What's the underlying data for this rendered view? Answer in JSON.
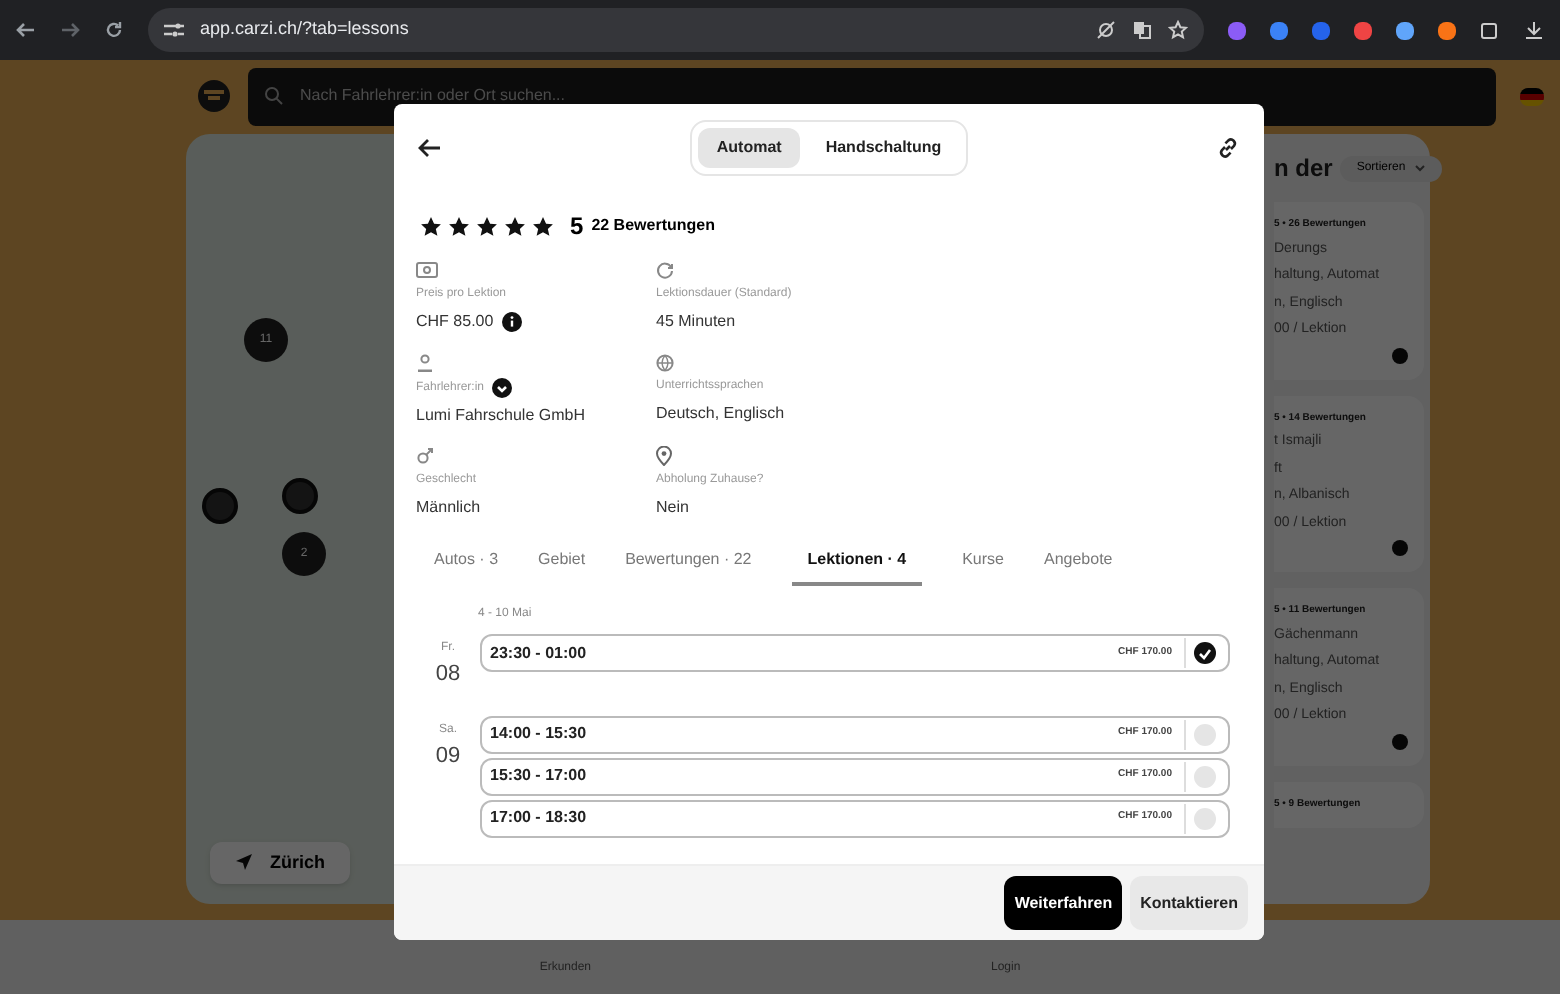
{
  "browser": {
    "url": "app.carzi.ch/?tab=lessons"
  },
  "search": {
    "placeholder": "Nach Fahrlehrer:in oder Ort suchen..."
  },
  "map": {
    "markers": [
      {
        "kind": "cluster",
        "label": "11"
      },
      {
        "kind": "cluster",
        "label": "2"
      },
      {
        "kind": "pin"
      },
      {
        "kind": "pin"
      }
    ],
    "locate_button": "Zürich"
  },
  "results": {
    "heading": "n der",
    "sort_button": "Sortieren",
    "cards": [
      {
        "lines": [
          "5 • 26 Bewertungen",
          "Derungs",
          "haltung, Automat",
          "n, Englisch",
          "00 / Lektion"
        ]
      },
      {
        "lines": [
          "5 • 14 Bewertungen",
          "t Ismajli",
          "ft",
          "n, Albanisch",
          "00 / Lektion"
        ]
      },
      {
        "lines": [
          "5 • 11 Bewertungen",
          "Gächenmann",
          "haltung, Automat",
          "n, Englisch",
          "00 / Lektion"
        ]
      },
      {
        "lines": [
          "5 • 9 Bewertungen"
        ]
      }
    ]
  },
  "bottom_nav": [
    "Erkunden",
    "Login"
  ],
  "modal": {
    "transmission": [
      {
        "label": "Automat",
        "selected": true
      },
      {
        "label": "Handschaltung",
        "selected": false
      }
    ],
    "rating": {
      "stars": 5,
      "score": "5",
      "reviews": "22 Bewertungen"
    },
    "info": [
      {
        "kind": "price",
        "label": "Preis pro Lektion",
        "value": "CHF 85.00",
        "info_icon": true
      },
      {
        "kind": "duration",
        "label": "Lektionsdauer (Standard)",
        "value": "45 Minuten"
      },
      {
        "kind": "person",
        "label": "Fahrlehrer:in",
        "value": "Lumi Fahrschule GmbH",
        "verified": true
      },
      {
        "kind": "language",
        "label": "Unterrichtssprachen",
        "value": "Deutsch, Englisch"
      },
      {
        "kind": "gender",
        "label": "Geschlecht",
        "value": "Männlich"
      },
      {
        "kind": "pickup",
        "label": "Abholung Zuhause?",
        "value": "Nein"
      }
    ],
    "tabs": [
      {
        "label": "Autos · 3",
        "selected": false
      },
      {
        "label": "Gebiet",
        "selected": false
      },
      {
        "label": "Bewertungen · 22",
        "selected": false
      },
      {
        "label": "Lektionen · 4",
        "selected": true
      },
      {
        "label": "Kurse",
        "selected": false
      },
      {
        "label": "Angebote",
        "selected": false
      }
    ],
    "week": "4 - 10 Mai",
    "days": [
      {
        "weekday": "Fr.",
        "day": "08",
        "slots": [
          {
            "time": "23:30 - 01:00",
            "price": "CHF 170.00",
            "selected": true
          }
        ]
      },
      {
        "weekday": "Sa.",
        "day": "09",
        "slots": [
          {
            "time": "14:00 - 15:30",
            "price": "CHF 170.00",
            "selected": false
          },
          {
            "time": "15:30 - 17:00",
            "price": "CHF 170.00",
            "selected": false
          },
          {
            "time": "17:00 - 18:30",
            "price": "CHF 170.00",
            "selected": false
          }
        ]
      }
    ],
    "buttons": [
      {
        "kind": "primary",
        "label": "Weiterfahren"
      },
      {
        "kind": "secondary",
        "label": "Kontaktieren"
      }
    ]
  }
}
